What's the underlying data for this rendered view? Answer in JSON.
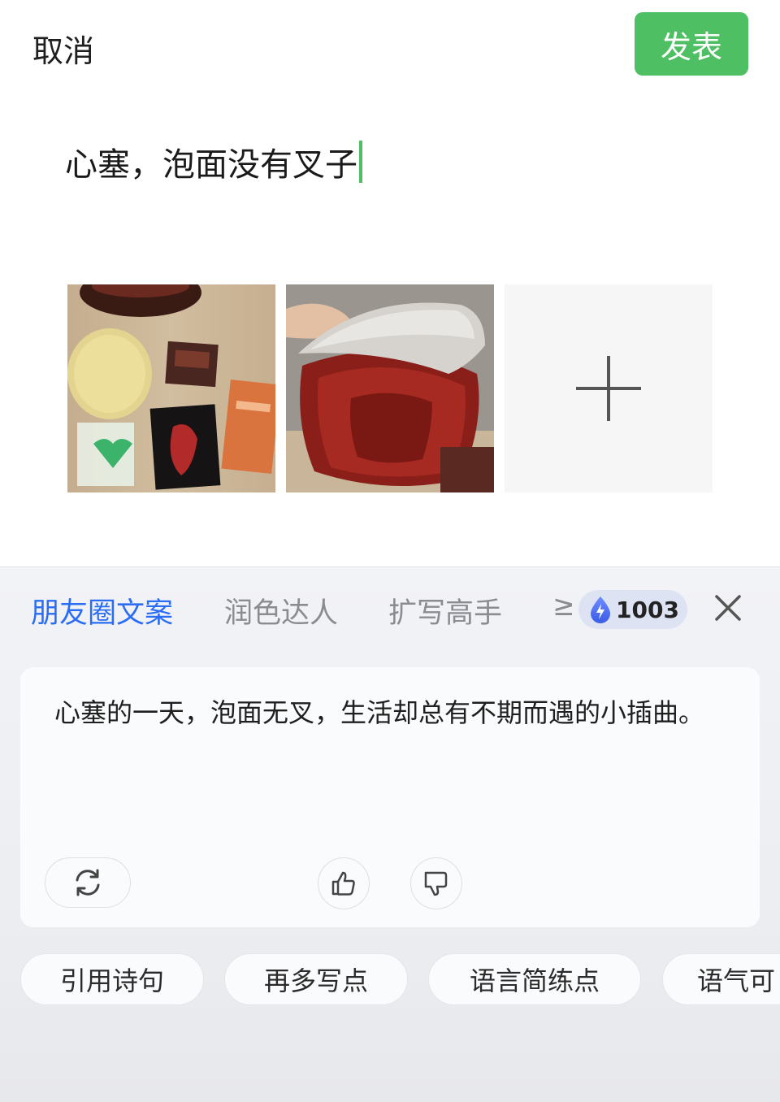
{
  "header": {
    "cancel_label": "取消",
    "publish_label": "发表"
  },
  "composer": {
    "text": "心塞，泡面没有叉子"
  },
  "ai_panel": {
    "tabs": [
      {
        "label": "朋友圈文案",
        "active": true
      },
      {
        "label": "润色达人",
        "active": false
      },
      {
        "label": "扩写高手",
        "active": false
      },
      {
        "label": "≥",
        "active": false
      }
    ],
    "credits": "1003",
    "result_text": "心塞的一天，泡面无叉，生活却总有不期而遇的小插曲。",
    "chips": [
      "引用诗句",
      "再多写点",
      "语言简练点",
      "语气可"
    ]
  },
  "colors": {
    "accent_green": "#4fbf63",
    "tab_active_blue": "#2a6df4"
  },
  "icons": [
    "close-icon",
    "refresh-icon",
    "thumbs-up-icon",
    "thumbs-down-icon",
    "plus-icon",
    "energy-drop-icon"
  ]
}
